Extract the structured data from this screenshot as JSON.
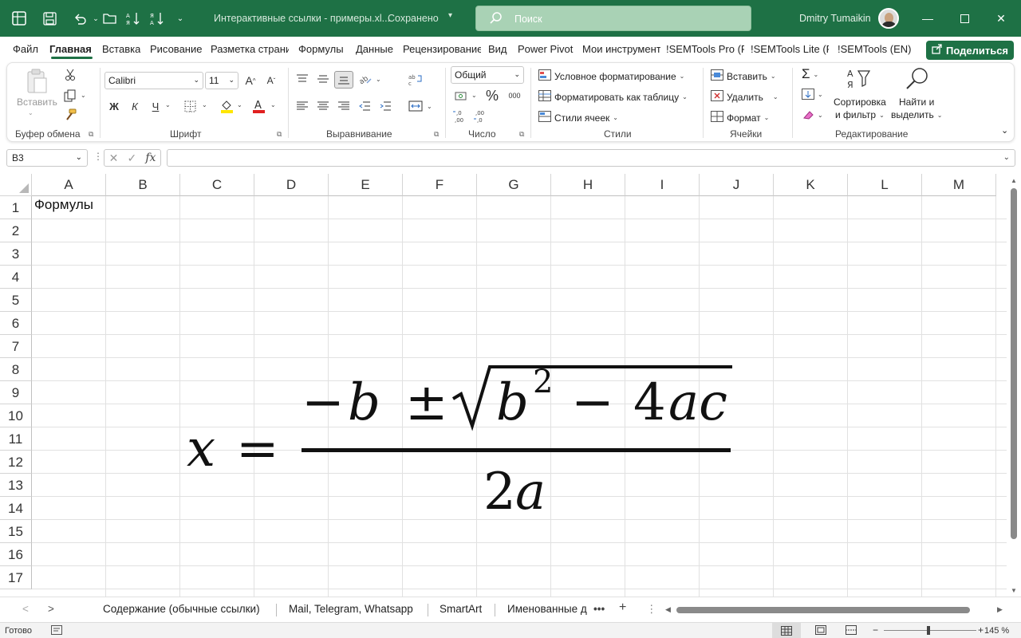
{
  "titlebar": {
    "title": "Интерактивные ссылки - примеры.xl...",
    "saved": "Сохранено",
    "search_placeholder": "Поиск",
    "user": "Dmitry Tumaikin",
    "bg": "#1e7145"
  },
  "tabs": [
    "Файл",
    "Главная",
    "Вставка",
    "Рисование",
    "Разметка страницы",
    "Формулы",
    "Данные",
    "Рецензирование",
    "Вид",
    "Power Pivot",
    "Мои инструменты",
    "!SEMTools Pro (RU)",
    "!SEMTools Lite (RU)",
    "!SEMTools (EN)"
  ],
  "share_label": "Поделиться",
  "ribbon": {
    "clipboard": {
      "paste": "Вставить",
      "label": "Буфер обмена"
    },
    "font": {
      "name": "Calibri",
      "size": "11",
      "bold": "Ж",
      "italic": "К",
      "underline": "Ч",
      "label": "Шрифт"
    },
    "alignment": {
      "label": "Выравнивание"
    },
    "number": {
      "format": "Общий",
      "percent": "%",
      "thousands": "000",
      "label": "Число"
    },
    "styles": {
      "conditional": "Условное форматирование",
      "as_table": "Форматировать как таблицу",
      "cell_styles": "Стили ячеек",
      "label": "Стили"
    },
    "cells": {
      "insert": "Вставить",
      "delete": "Удалить",
      "format": "Формат",
      "label": "Ячейки"
    },
    "editing": {
      "sort1": "Сортировка",
      "sort2": "и фильтр",
      "find1": "Найти и",
      "find2": "выделить",
      "label": "Редактирование"
    }
  },
  "formula_bar": {
    "name_box": "B3",
    "fx": "fx",
    "value": ""
  },
  "grid": {
    "columns": [
      "A",
      "B",
      "C",
      "D",
      "E",
      "F",
      "G",
      "H",
      "I",
      "J",
      "K",
      "L",
      "M"
    ],
    "rows": [
      "1",
      "2",
      "3",
      "4",
      "5",
      "6",
      "7",
      "8",
      "9",
      "10",
      "11",
      "12",
      "13",
      "14",
      "15",
      "16",
      "17"
    ],
    "a1": "Формулы"
  },
  "equation": {
    "lhs": "x",
    "eq": "=",
    "num_minus": "−",
    "num_b": "b",
    "num_pm": "±",
    "rad_b": "b",
    "rad_exp": "2",
    "rad_minus": "−",
    "rad_4": "4",
    "rad_ac": "ac",
    "den_2": "2",
    "den_a": "a"
  },
  "sheets": [
    "Содержание (обычные ссылки)",
    "Mail, Telegram, Whatsapp",
    "SmartArt",
    "Именованные диапазоны"
  ],
  "status": {
    "ready": "Готово",
    "zoom": "145 %"
  }
}
